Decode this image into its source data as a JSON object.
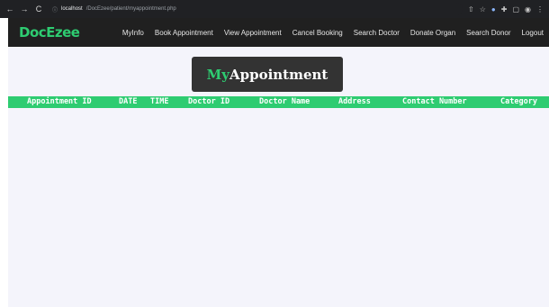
{
  "browser": {
    "back_icon": "←",
    "forward_icon": "→",
    "reload_icon": "C",
    "info_icon": "ⓘ",
    "url_host": "localhost",
    "url_path": "/DocEzee/patient/myappointment.php",
    "share_icon": "⇧",
    "star_icon": "☆",
    "extension_icon": "●",
    "puzzle_icon": "✚",
    "sidepanel_icon": "▢",
    "profile_icon": "◉",
    "menu_icon": "⋮"
  },
  "navbar": {
    "brand": "DocEzee",
    "items": [
      "MyInfo",
      "Book Appointment",
      "View Appointment",
      "Cancel Booking",
      "Search Doctor",
      "Donate Organ",
      "Search Donor",
      "Logout"
    ]
  },
  "page": {
    "title_accent": "My",
    "title_rest": "Appointment"
  },
  "table": {
    "columns": [
      "Appointment ID",
      "DATE",
      "TIME",
      "Doctor ID",
      "Doctor Name",
      "Address",
      "Contact Number",
      "Category"
    ],
    "rows": []
  },
  "colors": {
    "accent": "#2ecc71",
    "navbar_bg": "#202020",
    "content_bg": "#f4f4fb",
    "title_box_bg": "#333333"
  }
}
